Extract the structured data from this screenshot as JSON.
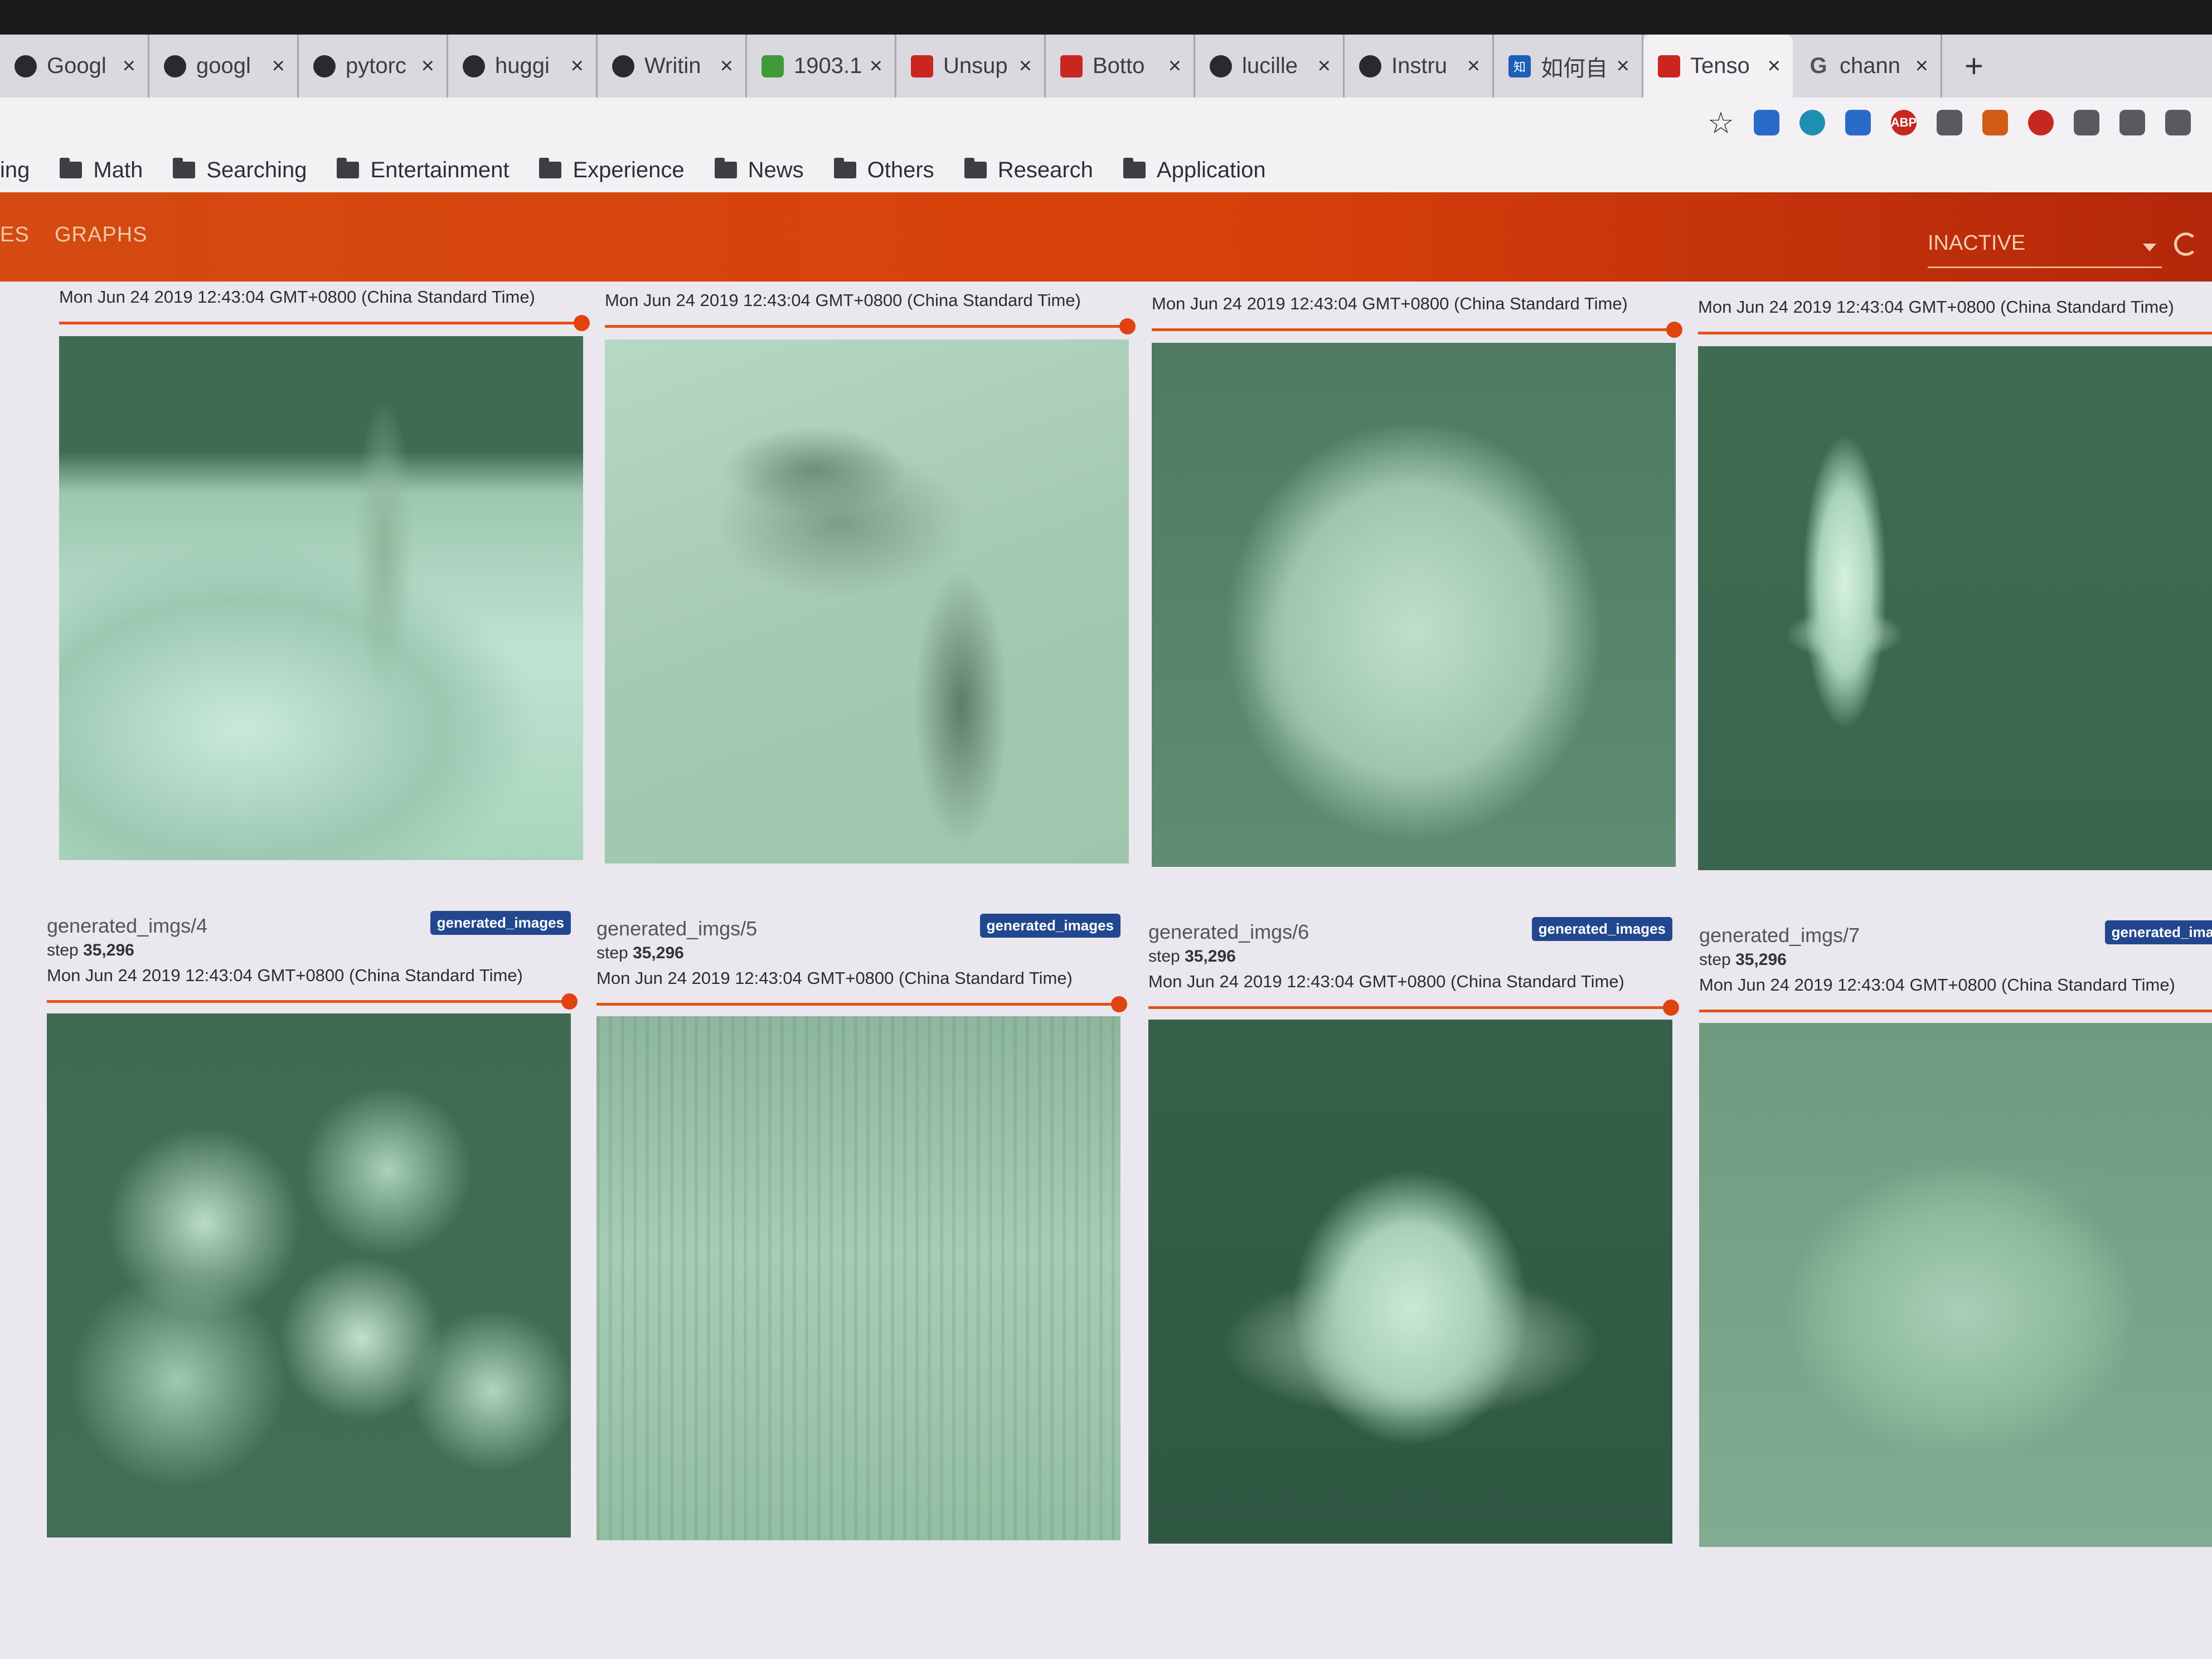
{
  "browser": {
    "tabs": [
      {
        "title": "Googl",
        "favicon": "document-icon"
      },
      {
        "title": "googl",
        "favicon": "github-icon"
      },
      {
        "title": "pytorc",
        "favicon": "github-icon"
      },
      {
        "title": "huggi",
        "favicon": "github-icon"
      },
      {
        "title": "Writin",
        "favicon": "github-icon"
      },
      {
        "title": "1903.1",
        "favicon": "smiley-icon"
      },
      {
        "title": "Unsup",
        "favicon": "slides-icon"
      },
      {
        "title": "Botto",
        "favicon": "slides-icon"
      },
      {
        "title": "lucille",
        "favicon": "globe-icon"
      },
      {
        "title": "Instru",
        "favicon": "logo-icon"
      },
      {
        "title": "如何自",
        "favicon": "zhihu-icon",
        "favicon_text": "知"
      },
      {
        "title": "Tenso",
        "favicon": "tensorboard-icon"
      },
      {
        "title": "chann",
        "favicon": "google-icon",
        "favicon_text": "G"
      }
    ],
    "active_tab_index": 11,
    "close_symbol": "×",
    "new_tab_symbol": "+",
    "bookmarks": [
      "ing",
      "Math",
      "Searching",
      "Entertainment",
      "Experience",
      "News",
      "Others",
      "Research",
      "Application"
    ],
    "extensions": [
      "star-icon",
      "translate-icon",
      "chrome-icon",
      "window-icon",
      "adblock-icon",
      "speed-icon",
      "fox-icon",
      "percent-icon",
      "shield-icon",
      "owl-icon",
      "more-icon"
    ],
    "adblock_label": "ABP"
  },
  "tensorboard": {
    "nav_partial": "ES",
    "nav_graphs": "GRAPHS",
    "run_selector": "INACTIVE",
    "accent_color": "#e0430e",
    "tag_color": "#22478f"
  },
  "cards_top": [
    {
      "date": "Mon Jun 24 2019 12:43:04 GMT+0800 (China Standard Time)"
    },
    {
      "date": "Mon Jun 24 2019 12:43:04 GMT+0800 (China Standard Time)"
    },
    {
      "date": "Mon Jun 24 2019 12:43:04 GMT+0800 (China Standard Time)"
    },
    {
      "date": "Mon Jun 24 2019 12:43:04 GMT+0800 (China Standard Time)"
    }
  ],
  "cards_bottom": [
    {
      "name": "generated_imgs/4",
      "tag": "generated_images",
      "step_label": "step",
      "step": "35,296",
      "date": "Mon Jun 24 2019 12:43:04 GMT+0800 (China Standard Time)"
    },
    {
      "name": "generated_imgs/5",
      "tag": "generated_images",
      "step_label": "step",
      "step": "35,296",
      "date": "Mon Jun 24 2019 12:43:04 GMT+0800 (China Standard Time)"
    },
    {
      "name": "generated_imgs/6",
      "tag": "generated_images",
      "step_label": "step",
      "step": "35,296",
      "date": "Mon Jun 24 2019 12:43:04 GMT+0800 (China Standard Time)"
    },
    {
      "name": "generated_imgs/7",
      "tag": "generated_images",
      "step_label": "step",
      "step": "35,296",
      "date": "Mon Jun 24 2019 12:43:04 GMT+0800 (China Standard Time)"
    }
  ]
}
